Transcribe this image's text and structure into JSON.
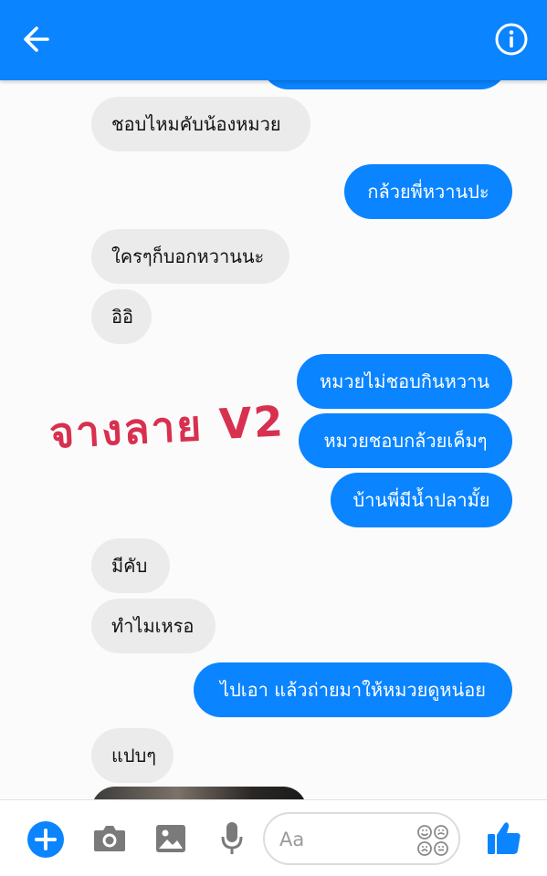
{
  "header": {
    "back_icon": "arrow-left-icon",
    "info_icon": "info-circle-icon",
    "bar_color": "#0a84ff"
  },
  "messages": [
    {
      "side": "in",
      "text": "ชอบไหมคับน้องหมวย"
    },
    {
      "side": "out",
      "text": "กล้วยพี่หวานปะ"
    },
    {
      "side": "in",
      "text": "ใครๆก็บอกหวานนะ"
    },
    {
      "side": "in",
      "text": "อิอิ"
    },
    {
      "side": "out",
      "text": "หมวยไม่ชอบกินหวาน"
    },
    {
      "side": "out",
      "text": "หมวยชอบกล้วยเค็มๆ"
    },
    {
      "side": "out",
      "text": "บ้านพี่มีน้ำปลามั้ย"
    },
    {
      "side": "in",
      "text": "มีคับ"
    },
    {
      "side": "in",
      "text": "ทำไมเหรอ"
    },
    {
      "side": "out",
      "text": "ไปเอา แล้วถ่ายมาให้หมวยดูหน่อย"
    },
    {
      "side": "in",
      "text": "แปบๆ"
    }
  ],
  "watermark": "จางลาย V2",
  "composer": {
    "placeholder": "Aa",
    "icons": [
      "plus-icon",
      "camera-icon",
      "image-icon",
      "microphone-icon",
      "emoji-icon",
      "thumbs-up-icon"
    ]
  },
  "colors": {
    "outgoing_bubble": "#0a84ff",
    "incoming_bubble": "#ebebeb",
    "watermark": "#d8304f"
  }
}
